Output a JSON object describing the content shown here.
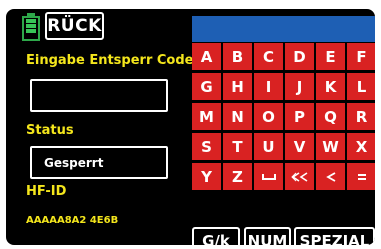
{
  "header": {
    "back_label": "RÜCK"
  },
  "left": {
    "entry_label": "Eingabe Entsperr Code",
    "code_value": "",
    "status_label": "Status",
    "status_value": "Gesperrt",
    "hfid_label": "HF-ID",
    "hfid_value": "AAAAA8A2 4E6B"
  },
  "keyboard": {
    "rows": [
      [
        "A",
        "B",
        "C",
        "D",
        "E",
        "F"
      ],
      [
        "G",
        "H",
        "I",
        "J",
        "K",
        "L"
      ],
      [
        "M",
        "N",
        "O",
        "P",
        "Q",
        "R"
      ],
      [
        "S",
        "T",
        "U",
        "V",
        "W",
        "X"
      ],
      [
        "Y",
        "Z"
      ]
    ],
    "special_keys": [
      "space-icon",
      "delete-all-icon",
      "backspace-icon",
      "enter-icon"
    ]
  },
  "bottom": {
    "case_label": "G/k",
    "num_label": "NUM",
    "special_label": "SPEZIAL"
  },
  "colors": {
    "key_red": "#d92222",
    "display_blue": "#1e5fb4",
    "label_yellow": "#f4e61c",
    "battery_green": "#2ea84a"
  }
}
